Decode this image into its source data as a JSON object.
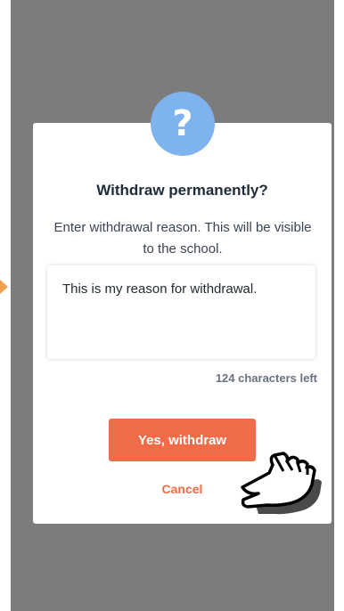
{
  "dialog": {
    "title": "Withdraw permanently?",
    "description": "Enter withdrawal reason. This will be visible to the school.",
    "reason_value": "This is my reason for withdrawal.",
    "characters_left": "124 characters left",
    "confirm_label": "Yes, withdraw",
    "cancel_label": "Cancel",
    "badge_symbol": "?"
  },
  "icons": {
    "badge": "question-icon",
    "cursor": "hand-pointer-icon"
  },
  "colors": {
    "overlay": "#7c7c7c",
    "badge": "#7fb3ee",
    "accent": "#f06b48",
    "title": "#1f2b3a"
  }
}
